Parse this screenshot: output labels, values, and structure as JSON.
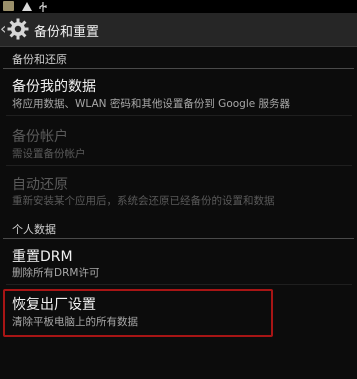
{
  "status_bar": {
    "icons": [
      "thumbnail-icon",
      "warning-icon",
      "usb-icon"
    ]
  },
  "action_bar": {
    "back_glyph": "‹",
    "title": "备份和重置",
    "icon": "gear-icon"
  },
  "sections": {
    "backup": {
      "header": "备份和还原",
      "items": [
        {
          "title": "备份我的数据",
          "subtitle": "将应用数据、WLAN 密码和其他设置备份到 Google 服务器",
          "enabled": true
        },
        {
          "title": "备份帐户",
          "subtitle": "需设置备份帐户",
          "enabled": false
        },
        {
          "title": "自动还原",
          "subtitle": "重新安装某个应用后，系统会还原已经备份的设置和数据",
          "enabled": false
        }
      ]
    },
    "personal": {
      "header": "个人数据",
      "items": [
        {
          "title": "重置DRM",
          "subtitle": "删除所有DRM许可",
          "enabled": true
        },
        {
          "title": "恢复出厂设置",
          "subtitle": "清除平板电脑上的所有数据",
          "enabled": true
        }
      ]
    }
  },
  "colors": {
    "background": "#0c0c0c",
    "action_bar": "#262626",
    "highlight": "#a81515"
  }
}
